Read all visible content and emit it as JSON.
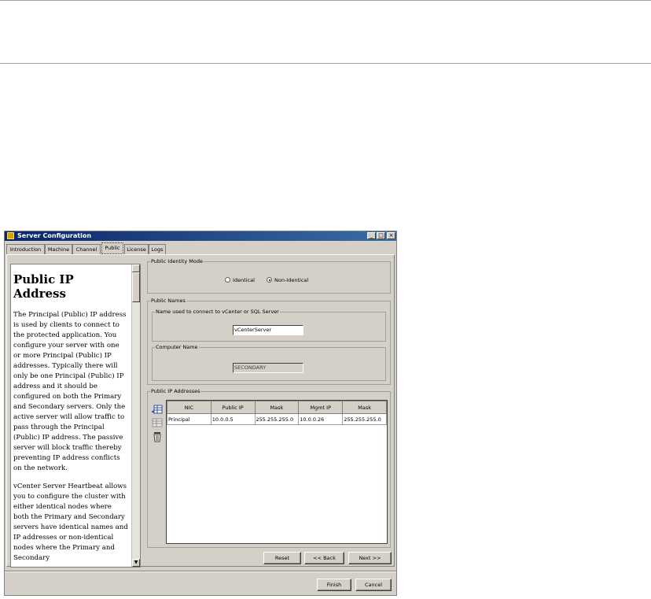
{
  "window": {
    "title": "Server Configuration",
    "minimize": "_",
    "maximize": "□",
    "close": "×"
  },
  "tabs": [
    {
      "label": "Introduction"
    },
    {
      "label": "Machine"
    },
    {
      "label": "Channel"
    },
    {
      "label": "Public"
    },
    {
      "label": "License"
    },
    {
      "label": "Logs"
    }
  ],
  "active_tab": "Public",
  "help": {
    "heading": "Public IP Address",
    "paragraphs": [
      "The Principal (Public) IP address is used by clients to connect to the protected application. You configure your server with one or more Principal (Public) IP addresses. Typically there will only be one Principal (Public) IP address and it should be configured on both the Primary and Secondary servers. Only the active server will allow traffic to pass through the Principal (Public) IP address. The passive server will block traffic thereby preventing IP address conflicts on the network.",
      "vCenter Server Heartbeat allows you to configure the cluster with either identical nodes where both the Primary and Secondary servers have identical names and IP addresses or non-identical nodes where the Primary and Secondary"
    ]
  },
  "identity_mode": {
    "label": "Public Identity Mode",
    "options": [
      {
        "label": "Identical",
        "selected": false
      },
      {
        "label": "Non-Identical",
        "selected": true
      }
    ]
  },
  "public_names": {
    "label": "Public Names",
    "vcenter_group_label": "Name used to connect to vCenter or SQL Server",
    "vcenter_name": "vCenterServer",
    "computer_group_label": "Computer Name",
    "computer_name": "SECONDARY"
  },
  "ip_addresses": {
    "label": "Public IP Addresses",
    "toolbar_icons": [
      "add-row-icon",
      "edit-row-icon",
      "trash-icon"
    ],
    "columns": [
      "NIC",
      "Public IP",
      "Mask",
      "Mgmt IP",
      "Mask"
    ],
    "rows": [
      [
        "Principal",
        "10.0.0.5",
        "255.255.255.0",
        "10.0.0.26",
        "255.255.255.0"
      ]
    ]
  },
  "buttons": {
    "reset": "Reset",
    "back": "<< Back",
    "next": "Next >>",
    "finish": "Finish",
    "cancel": "Cancel"
  },
  "colors": {
    "title_bar": "#0a246a",
    "window_bg": "#d4d0c8"
  }
}
